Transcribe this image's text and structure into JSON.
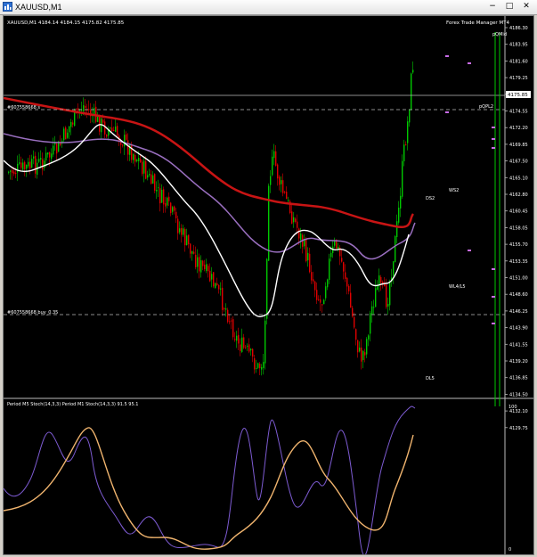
{
  "window": {
    "title": "XAUUSD,M1",
    "controls": {
      "minimize": "−",
      "maximize": "□",
      "close": "✕"
    }
  },
  "chart": {
    "symbol_info": "XAUUSD,M1  4184.14 4184.15 4175.82 4175.85",
    "expert_label": "Forex Trade Manager MT4",
    "current_price_label": "4175.85",
    "price_ticks": [
      "4186.30",
      "4183.95",
      "4181.60",
      "4179.25",
      "4176.90",
      "4174.55",
      "4172.20",
      "4169.85",
      "4167.50",
      "4165.10",
      "4162.80",
      "4160.45",
      "4158.05",
      "4155.70",
      "4153.35",
      "4151.00",
      "4148.60",
      "4146.25",
      "4143.90",
      "4141.55",
      "4139.20",
      "4136.85",
      "4134.50",
      "4132.10",
      "4129.75"
    ],
    "order_labels": {
      "upper": "#607558668 s",
      "lower": "#607558668 buy_0.35"
    },
    "level_labels": [
      {
        "id": "qm",
        "text": "pQMid"
      },
      {
        "id": "qpl",
        "text": "pQPL2"
      },
      {
        "id": "ds2",
        "text": "DS2"
      },
      {
        "id": "ws2",
        "text": "WS2"
      },
      {
        "id": "wl45",
        "text": "WL4/L5"
      },
      {
        "id": "dl5",
        "text": "DL5"
      }
    ]
  },
  "indicator": {
    "label": "Period M5 Stoch(14,3,3)  Period M1 Stoch(14,3,3) 91.5 95.1",
    "ticks": [
      "100",
      "0"
    ]
  },
  "colors": {
    "bull": "#00c800",
    "bear": "#e00000",
    "slow_ma": "#c81414",
    "mid_ma": "#9a6fc0",
    "fast_ma": "#ffffff",
    "stoch_main": "#7d5bd2",
    "stoch_signal": "#f0b46e",
    "grid": "#aaaaaa",
    "marker": "#c96ce8",
    "vline": "#00c800"
  }
}
